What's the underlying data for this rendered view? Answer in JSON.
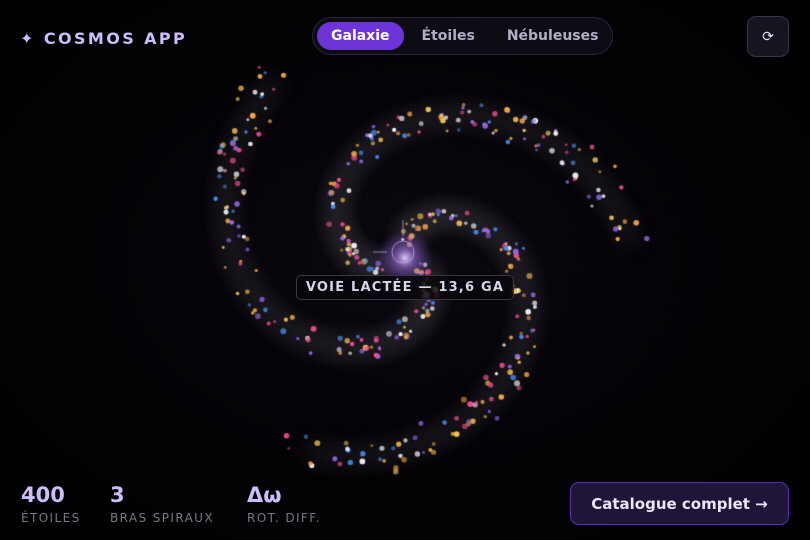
{
  "header": {
    "brand_icon": "sparkle-icon",
    "brand_icon_glyph": "✦",
    "brand_name": "COSMOS APP",
    "tabs": [
      {
        "label": "Galaxie",
        "active": true
      },
      {
        "label": "Étoiles",
        "active": false
      },
      {
        "label": "Nébuleuses",
        "active": false
      }
    ],
    "refresh_icon": "refresh-icon",
    "refresh_glyph": "⟳"
  },
  "galaxy": {
    "label": "VOIE LACTÉE — 13,6 GA",
    "arms": 3,
    "star_count": 400,
    "star_colors": [
      "#f2c14e",
      "#ec4d8e",
      "#4a8ff0",
      "#f4f2f8",
      "#9a6bf0",
      "#f0a640"
    ]
  },
  "footer": {
    "stats": [
      {
        "value": "400",
        "label": "ÉTOILES"
      },
      {
        "value": "3",
        "label": "BRAS SPIRAUX"
      },
      {
        "value": "Δω",
        "label": "ROT. DIFF."
      }
    ],
    "cta_label": "Catalogue complet →"
  },
  "colors": {
    "accent": "#6d34d8",
    "accent_text": "#cdbdfb",
    "background": "#000000"
  }
}
